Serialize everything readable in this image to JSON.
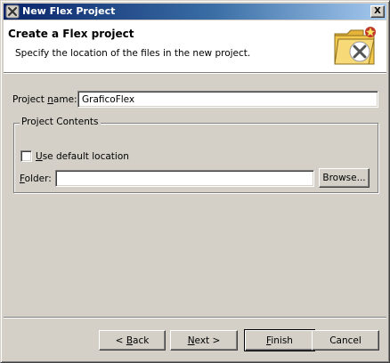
{
  "window": {
    "title": "New Flex Project",
    "close_glyph": "X",
    "app_icon": "flex-logo-icon"
  },
  "banner": {
    "title": "Create a Flex project",
    "description": "Specify the location of the files in the new project.",
    "icon": "flex-folder-wizard-icon"
  },
  "project_name": {
    "label_prefix": "Project ",
    "label_mnemonic": "n",
    "label_suffix": "ame:",
    "value": "GraficoFlex"
  },
  "project_contents": {
    "legend": "Project Contents",
    "use_default": {
      "label_mnemonic": "U",
      "label_rest": "se default location",
      "checked": false
    },
    "folder": {
      "label_mnemonic": "F",
      "label_rest": "older:",
      "value": ""
    },
    "browse_label": "Browse..."
  },
  "buttons": {
    "back": {
      "prefix": "< ",
      "mnemonic": "B",
      "rest": "ack"
    },
    "next": {
      "mnemonic": "N",
      "rest": "ext >"
    },
    "finish": {
      "mnemonic": "F",
      "rest": "inish"
    },
    "cancel": "Cancel"
  },
  "colors": {
    "titlebar_start": "#0a246a",
    "titlebar_end": "#a6caf0",
    "face": "#d4d0c8",
    "folder_yellow": "#f2c94c",
    "flex_badge": "#c0392b"
  }
}
